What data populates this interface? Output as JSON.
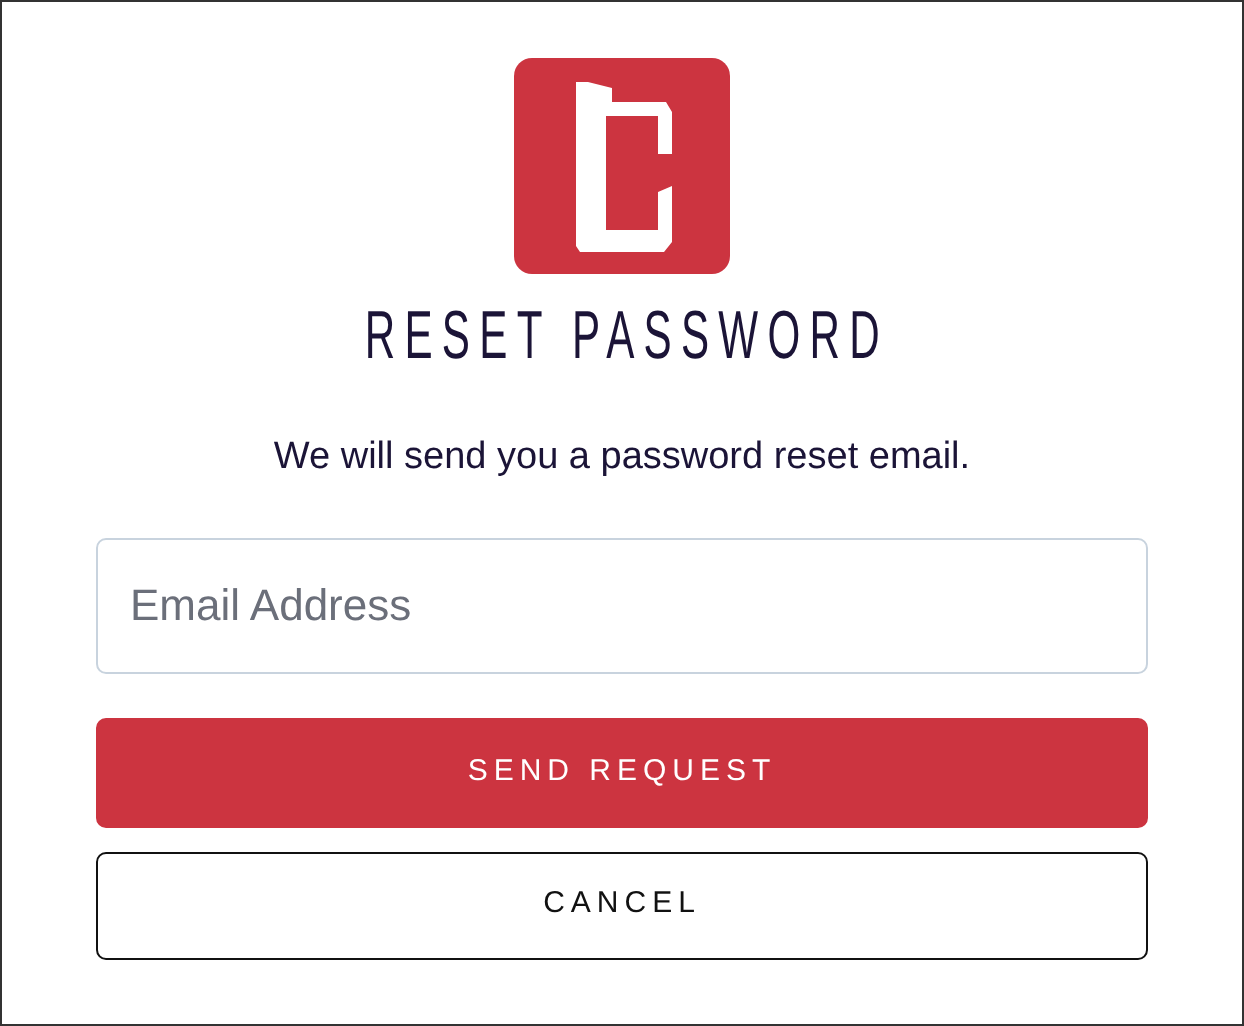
{
  "title": "RESET PASSWORD",
  "message": "We will send you a password reset email.",
  "email_field": {
    "placeholder": "Email Address"
  },
  "buttons": [
    {
      "label": "SEND REQUEST",
      "kind": "primary"
    },
    {
      "label": "CANCEL",
      "kind": "outline"
    }
  ]
}
